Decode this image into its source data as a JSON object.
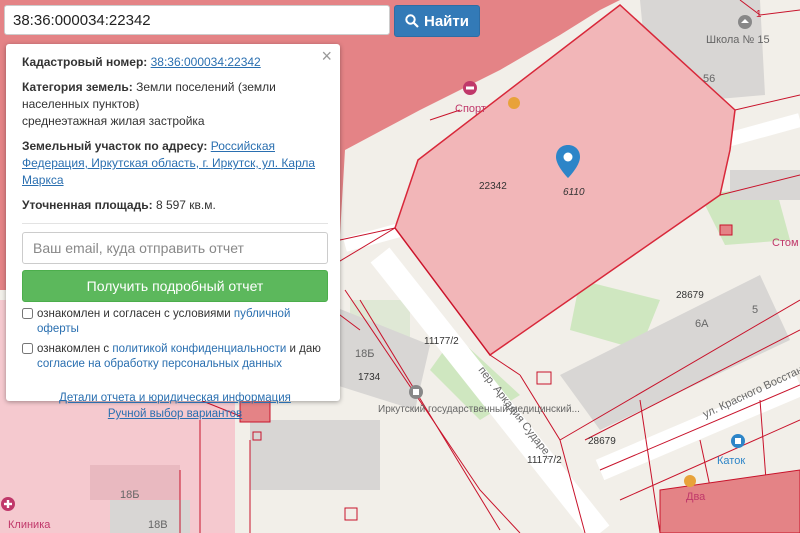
{
  "search": {
    "value": "38:36:000034:22342",
    "button_label": "Найти",
    "button_icon": "search-icon"
  },
  "panel": {
    "close_symbol": "×",
    "cadastral_label": "Кадастровый номер:",
    "cadastral_value": "38:36:000034:22342",
    "category_label": "Категория земель:",
    "category_text": "Земли поселений (земли населенных пунктов)",
    "category_sub": "среднеэтажная жилая застройка",
    "address_label": "Земельный участок по адресу:",
    "address_link": "Российская Федерация, Иркутская область, г. Иркутск, ул. Карла Маркса",
    "area_label": "Уточненная площадь:",
    "area_value": "8 597 кв.м.",
    "email_placeholder": "Ваш email, куда отправить отчет",
    "get_report_button": "Получить подробный отчет",
    "consent1_prefix": "ознакомлен и согласен с условиями",
    "consent1_link": "публичной оферты",
    "consent2_prefix": "ознакомлен с",
    "consent2_link1": "политикой конфиденциальности",
    "consent2_mid": "и даю",
    "consent2_link2": "согласие на обработку персональных данных",
    "details_link": "Детали отчета и юридическая информация",
    "manual_link": "Ручной выбор вариантов"
  },
  "map": {
    "labels": {
      "parcel_main": "22342",
      "marker_label": "6110",
      "school": "Школа № 15",
      "num_56": "56",
      "num_1": "1",
      "sport": "Спорт",
      "stom": "Стом",
      "num_28679_a": "28679",
      "num_28679_b": "28679",
      "num_6a": "6А",
      "num_5": "5",
      "num_11177_a": "11177/2",
      "num_11177_b": "11177/2",
      "num_18b_a": "18Б",
      "num_18b_b": "18Б",
      "num_18v": "18В",
      "num_1734": "1734",
      "institute": "Иркутский государственный медицинский...",
      "street_krasnogo": "ул. Красного Восстания",
      "street_sudar": "пер. Аркадия Сударе...",
      "klinika": "Клиника",
      "katok": "Каток",
      "dva": "Два"
    },
    "colors": {
      "parcel_fill": "#f2b6b8",
      "parcel_stroke": "#d8283a",
      "red_area": "#e48386",
      "building": "#d8d6d4",
      "green": "#cfe7c0",
      "pink_building": "#f5c9cf",
      "marker": "#2d85c8",
      "line": "#c8132b"
    }
  }
}
